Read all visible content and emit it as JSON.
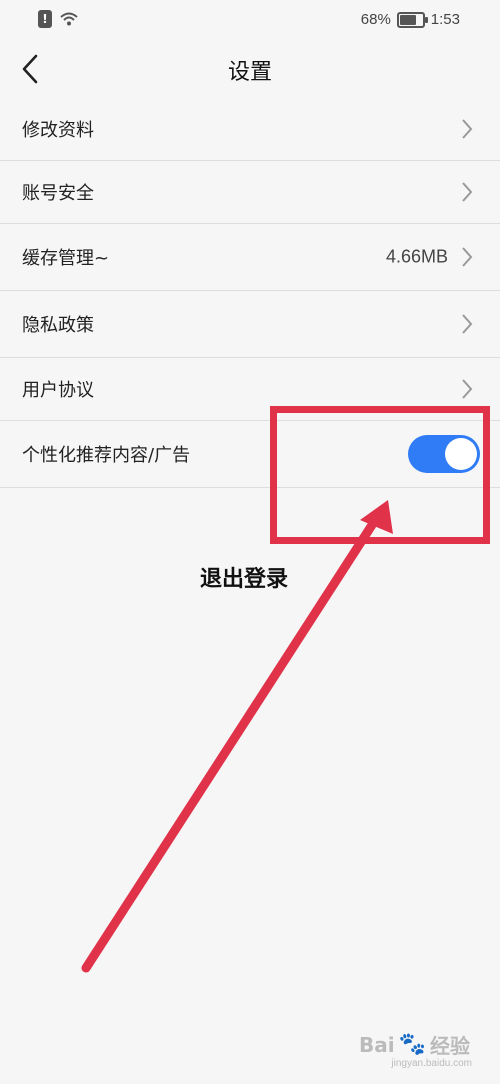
{
  "status_bar": {
    "alert_icon_text": "!",
    "battery": "68%",
    "battery_level": 0.68,
    "time": "1:53"
  },
  "header": {
    "title": "设置"
  },
  "settings": [
    {
      "label": "修改资料",
      "value": ""
    },
    {
      "label": "账号安全",
      "value": ""
    },
    {
      "label": "缓存管理~",
      "value": "4.66MB"
    },
    {
      "label": "隐私政策",
      "value": ""
    },
    {
      "label": "用户协议",
      "value": ""
    }
  ],
  "personalization": {
    "label": "个性化推荐内容/广告",
    "toggle_on": true
  },
  "logout": {
    "label": "退出登录"
  },
  "watermark": {
    "text_prefix": "Bai",
    "text_suffix": "经验",
    "sub": "jingyan.baidu.com"
  },
  "colors": {
    "accent_blue": "#2f7cf6",
    "annotation_red": "#e0334a"
  }
}
